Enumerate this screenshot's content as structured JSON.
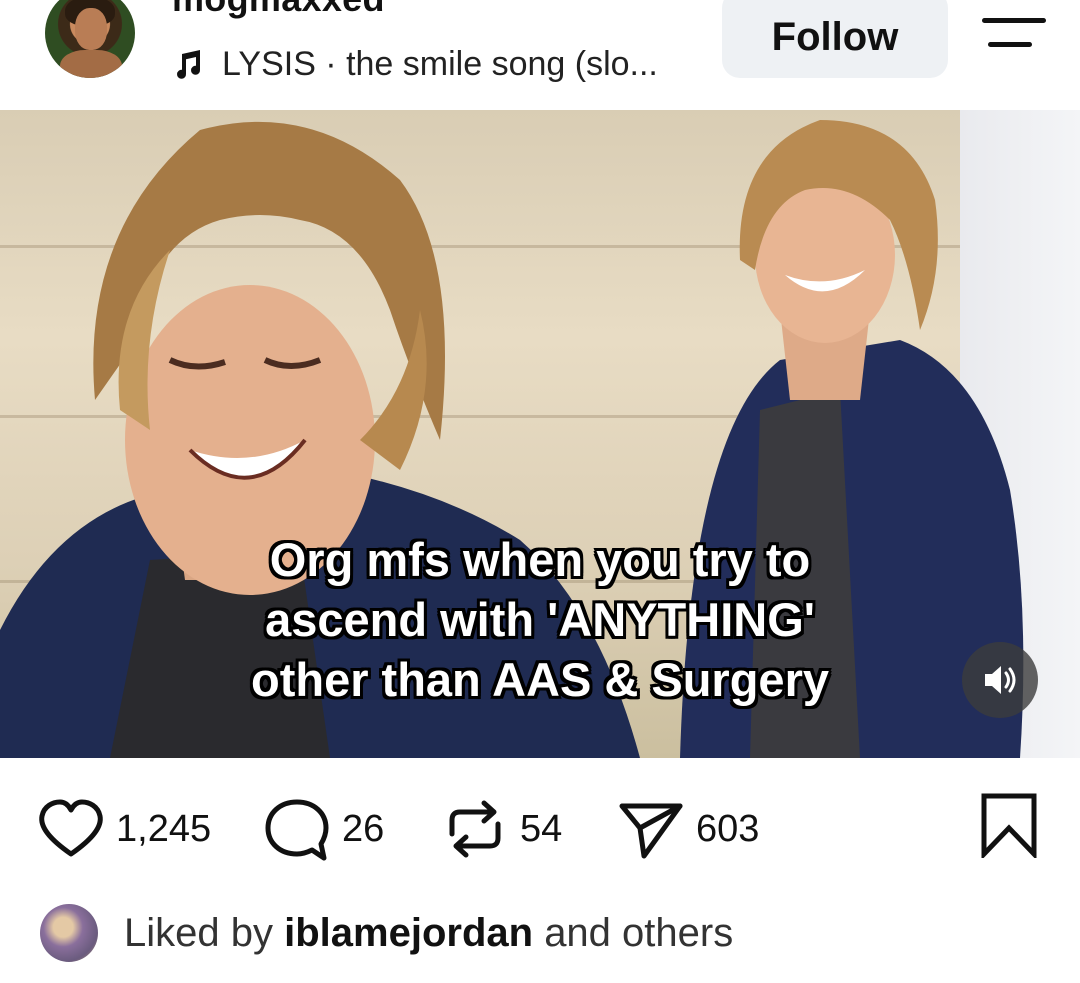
{
  "post": {
    "username": "mogmaxxed",
    "music": {
      "icon": "music-note-icon",
      "text": "LYSIS · the smile song (slo..."
    },
    "follow_label": "Follow",
    "menu_icon": "menu-icon"
  },
  "media": {
    "caption_lines": [
      "Org mfs when you try to",
      "ascend with 'ANYTHING'",
      "other than AAS & Surgery"
    ],
    "sound_icon": "volume-on-icon"
  },
  "actions": {
    "likes": "1,245",
    "comments": "26",
    "reposts": "54",
    "shares": "603",
    "icons": [
      "heart-icon",
      "comment-icon",
      "repost-icon",
      "send-icon",
      "bookmark-icon"
    ]
  },
  "liked_by": {
    "prefix": "Liked by",
    "user": "iblamejordan",
    "suffix": "and others"
  },
  "colors": {
    "text": "#111111",
    "follow_bg": "#eef1f4",
    "background": "#ffffff"
  }
}
